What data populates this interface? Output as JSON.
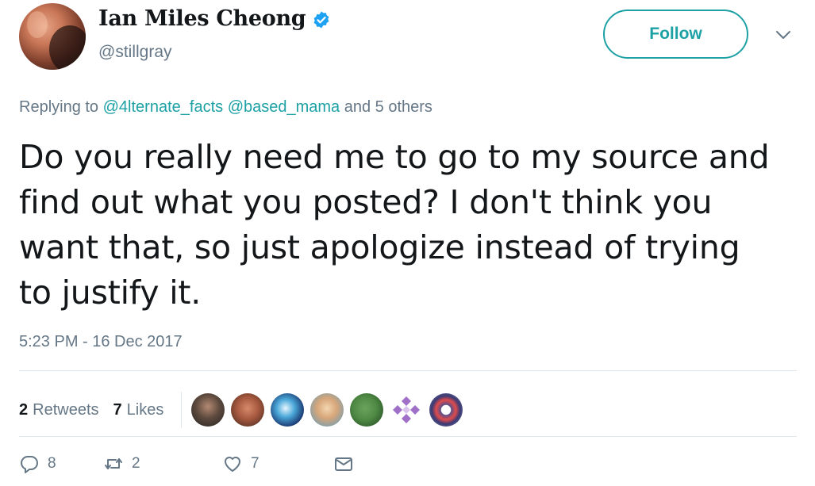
{
  "author": {
    "display_name": "Ian Miles Cheong",
    "handle": "@stillgray",
    "verified": true
  },
  "header": {
    "follow_label": "Follow"
  },
  "reply": {
    "prefix": "Replying to",
    "mentions": [
      "@4lternate_facts",
      "@based_mama"
    ],
    "suffix": "and 5 others"
  },
  "tweet": {
    "text": "Do you really need me to go to my source and find out what you posted? I don't think you want that, so just apologize instead of trying to justify it.",
    "timestamp": "5:23 PM - 16 Dec 2017"
  },
  "stats": {
    "retweets_count": "2",
    "retweets_label": "Retweets",
    "likes_count": "7",
    "likes_label": "Likes"
  },
  "actions": {
    "reply_count": "8",
    "retweet_count": "2",
    "like_count": "7"
  },
  "icons": {
    "verified": "verified-badge-icon",
    "menu": "chevron-down-icon",
    "reply": "reply-icon",
    "retweet": "retweet-icon",
    "like": "heart-icon",
    "dm": "envelope-icon"
  },
  "colors": {
    "accent": "#1da1a5",
    "verified": "#1da1f2",
    "muted": "#657786",
    "text": "#14171a"
  }
}
